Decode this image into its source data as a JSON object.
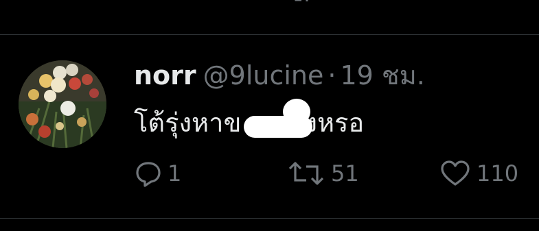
{
  "tweet": {
    "display_name": "norr",
    "handle": "@9lucine",
    "separator": "·",
    "time": "19 ชม.",
    "text_before_redaction": "โต้รุ่งหาข",
    "text_after_redaction": "งหรอ"
  },
  "actions": {
    "reply": {
      "icon": "reply-icon",
      "count": "1"
    },
    "retweet": {
      "icon": "retweet-icon",
      "count": "51"
    },
    "like": {
      "icon": "heart-icon",
      "count": "110"
    }
  },
  "colors": {
    "background": "#000000",
    "primary_text": "#e7e9ea",
    "secondary_text": "#71767b",
    "divider": "#2f3336",
    "redaction": "#ffffff"
  }
}
